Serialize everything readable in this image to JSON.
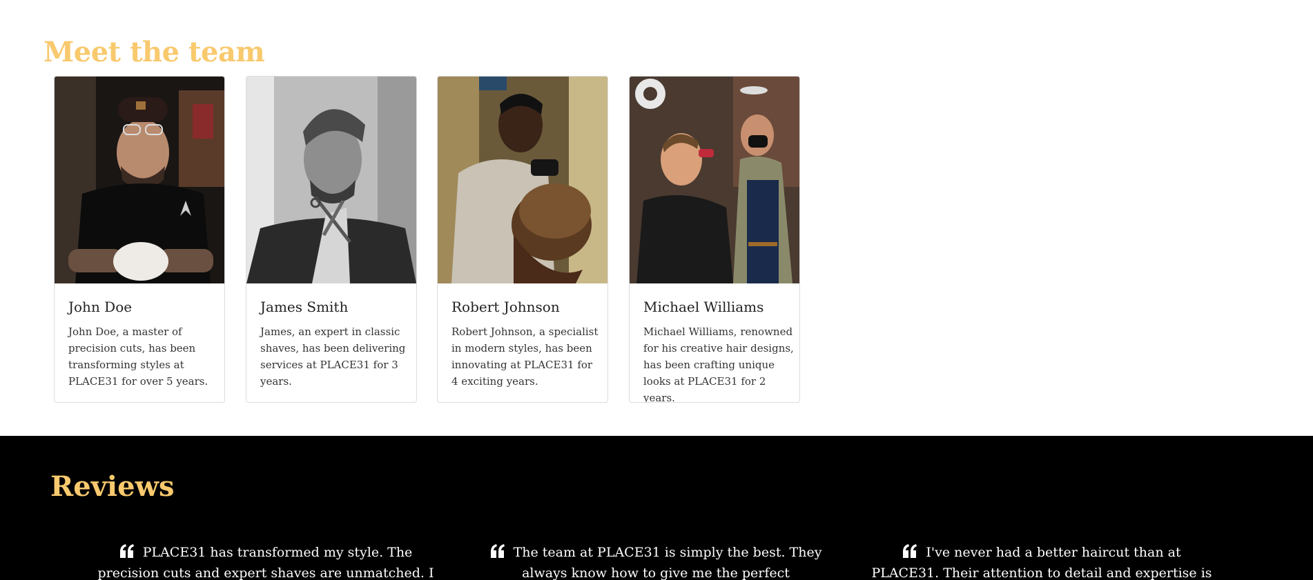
{
  "team": {
    "title": "Meet the team",
    "members": [
      {
        "name": "John Doe",
        "bio": "John Doe, a master of precision cuts, has been transforming styles at PLACE31 for over 5 years."
      },
      {
        "name": "James Smith",
        "bio": "James, an expert in classic shaves, has been delivering services at PLACE31 for 3 years."
      },
      {
        "name": "Robert Johnson",
        "bio": "Robert Johnson, a specialist in modern styles, has been innovating at PLACE31 for 4 exciting years."
      },
      {
        "name": "Michael Williams",
        "bio": "Michael Williams, renowned for his creative hair designs, has been crafting unique looks at PLACE31 for 2 years."
      }
    ]
  },
  "reviews": {
    "title": "Reviews",
    "items": [
      {
        "text": "PLACE31 has transformed my style. The precision cuts and expert shaves are unmatched. I"
      },
      {
        "text": "The team at PLACE31 is simply the best. They always know how to give me the perfect"
      },
      {
        "text": "I've never had a better haircut than at PLACE31. Their attention to detail and expertise is"
      }
    ]
  },
  "colors": {
    "accent": "#f9c96e",
    "dark_bg": "#000000"
  },
  "icons": {
    "quote": "quote-left-icon"
  }
}
